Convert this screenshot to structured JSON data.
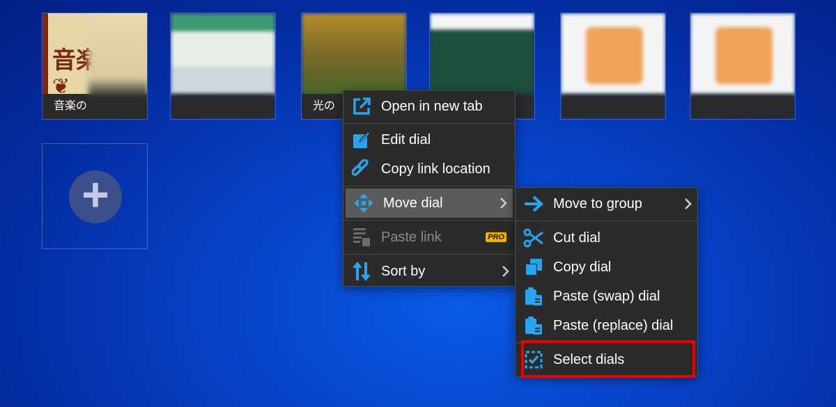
{
  "dials": [
    {
      "caption": "音楽の",
      "logo_text": "音楽"
    },
    {
      "caption": ""
    },
    {
      "caption": "光の"
    },
    {
      "caption": ""
    },
    {
      "caption": ""
    },
    {
      "caption": ""
    }
  ],
  "add_dial": {
    "symbol": "+"
  },
  "context_menu": {
    "items": [
      {
        "label": "Open in new tab",
        "icon": "open-in-new-tab-icon"
      },
      {
        "label": "Edit dial",
        "icon": "edit-icon"
      },
      {
        "label": "Copy link location",
        "icon": "link-icon"
      },
      {
        "label": "Move dial",
        "icon": "move-arrows-icon",
        "has_submenu": true,
        "highlighted": true
      },
      {
        "label": "Paste link",
        "icon": "paste-link-icon",
        "disabled": true,
        "badge": "PRO"
      },
      {
        "label": "Sort by",
        "icon": "sort-icon",
        "has_submenu": true
      }
    ]
  },
  "submenu": {
    "items": [
      {
        "label": "Move to group",
        "icon": "arrow-right-icon",
        "has_submenu": true
      },
      {
        "label": "Cut dial",
        "icon": "scissors-icon"
      },
      {
        "label": "Copy dial",
        "icon": "copy-icon"
      },
      {
        "label": "Paste (swap) dial",
        "icon": "clipboard-icon"
      },
      {
        "label": "Paste (replace) dial",
        "icon": "clipboard-icon"
      },
      {
        "label": "Select dials",
        "icon": "select-checkbox-icon",
        "outlined": true
      }
    ]
  },
  "colors": {
    "icon_blue": "#29a3f0",
    "menu_bg": "#2b2b2b",
    "highlight_bg": "#5b5b5b",
    "pro_badge": "#f4b400",
    "annotation_red": "#ee0000"
  }
}
